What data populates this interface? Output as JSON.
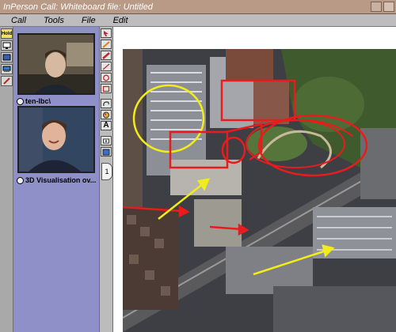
{
  "window": {
    "title": "InPerson Call: Whiteboard file: Untitled"
  },
  "menu": [
    {
      "label": "Call"
    },
    {
      "label": "Tools"
    },
    {
      "label": "File"
    },
    {
      "label": "Edit"
    }
  ],
  "left_toolbar": {
    "hold_label": "Hold",
    "tools": [
      "hold-icon",
      "monitor-icon",
      "phone-icon",
      "computer-icon",
      "pen-icon"
    ]
  },
  "video": {
    "participants": [
      {
        "name": "ten-lbc\\"
      },
      {
        "name": "3D Visualisation ov..."
      }
    ]
  },
  "drawing_tools": {
    "icons": [
      "pointer-icon",
      "pencil-icon",
      "marker-icon",
      "line-icon",
      "circle-icon",
      "rectangle-icon",
      "lasso-icon",
      "palette-icon",
      "text-icon",
      "eraser-icon",
      "screen-icon"
    ],
    "text_tool_label": "A",
    "page_tab_label": "1"
  },
  "annotations": {
    "colors": {
      "red": "#e81c1c",
      "yellow": "#f2ec1a"
    }
  }
}
